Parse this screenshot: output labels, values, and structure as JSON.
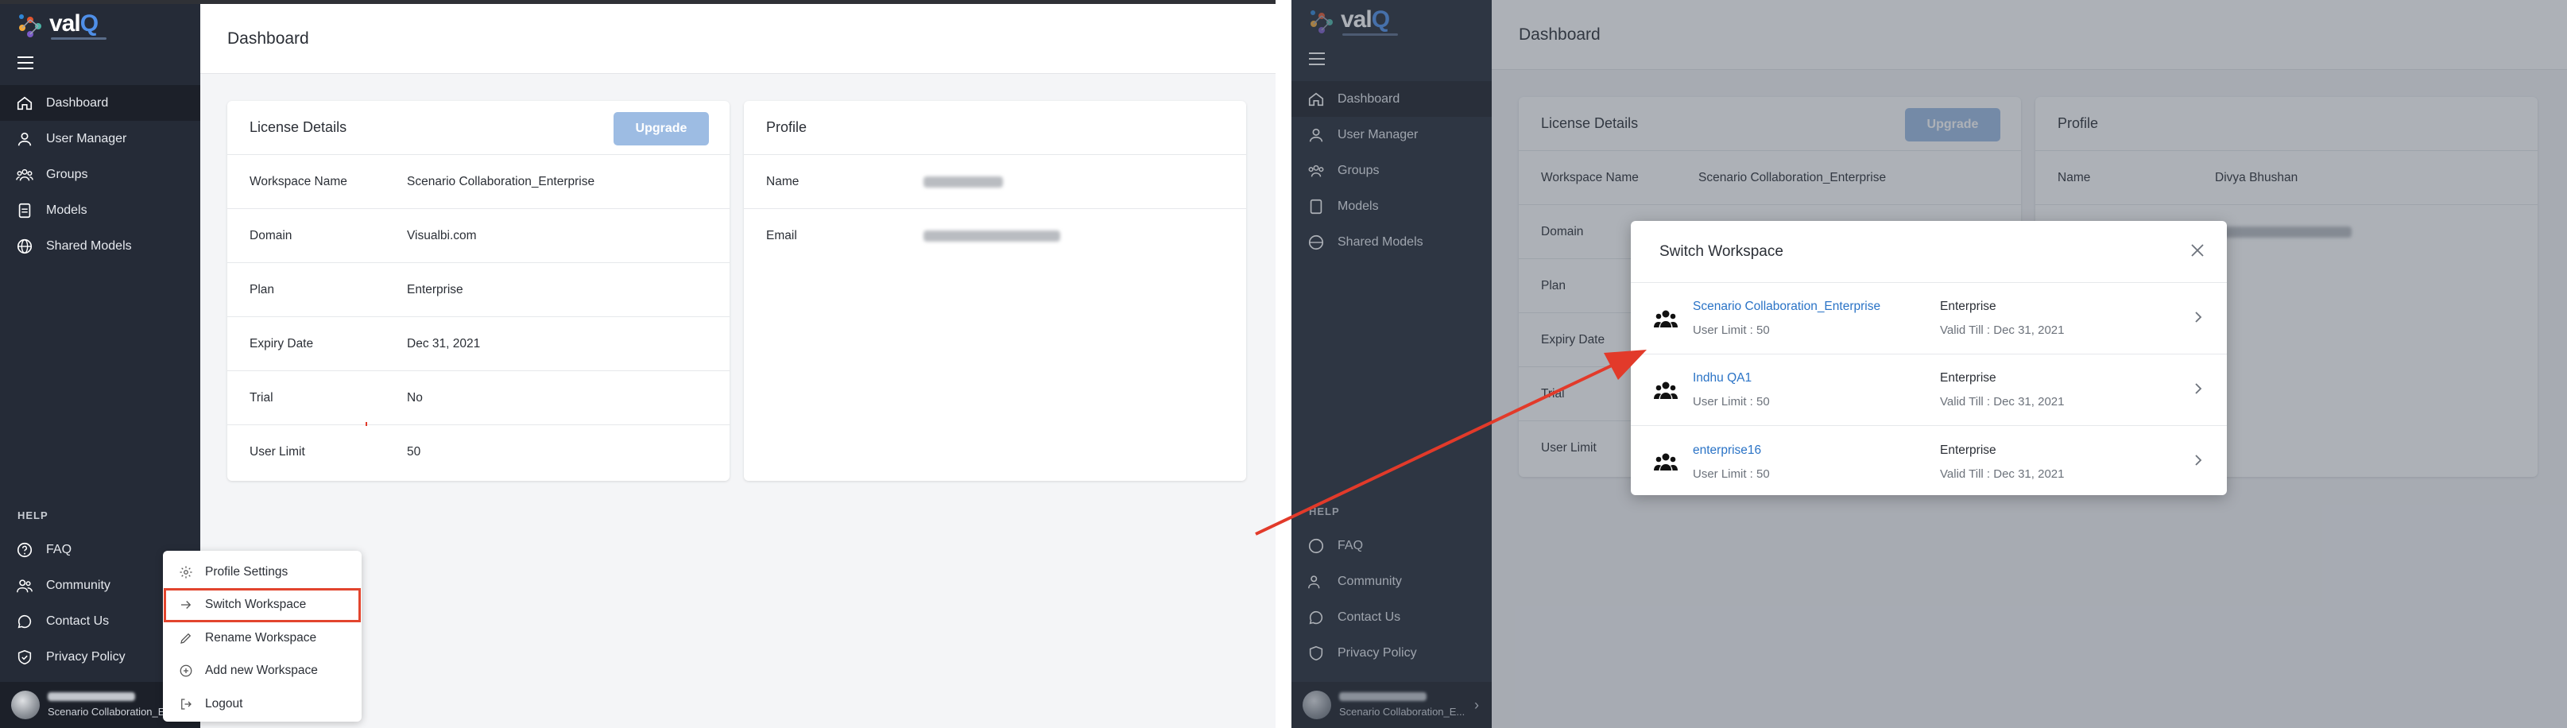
{
  "left": {
    "brand": {
      "word_a": "val",
      "word_b": "Q"
    },
    "nav": [
      {
        "label": "Dashboard",
        "icon": "home-icon",
        "active": true
      },
      {
        "label": "User Manager",
        "icon": "user-icon"
      },
      {
        "label": "Groups",
        "icon": "groups-icon"
      },
      {
        "label": "Models",
        "icon": "document-icon"
      },
      {
        "label": "Shared Models",
        "icon": "globe-icon"
      }
    ],
    "help_title": "HELP",
    "help": [
      {
        "label": "FAQ",
        "icon": "question-icon"
      },
      {
        "label": "Community",
        "icon": "community-icon"
      },
      {
        "label": "Contact Us",
        "icon": "chat-icon"
      },
      {
        "label": "Privacy Policy",
        "icon": "shield-icon"
      }
    ],
    "user_workspace": "Scenario Collaboration_E",
    "page_title": "Dashboard",
    "license": {
      "title": "License Details",
      "upgrade": "Upgrade",
      "rows": [
        {
          "k": "Workspace Name",
          "v": "Scenario Collaboration_Enterprise"
        },
        {
          "k": "Domain",
          "v": "Visualbi.com"
        },
        {
          "k": "Plan",
          "v": "Enterprise"
        },
        {
          "k": "Expiry Date",
          "v": "Dec 31, 2021"
        },
        {
          "k": "Trial",
          "v": "No"
        },
        {
          "k": "User Limit",
          "v": "50"
        }
      ]
    },
    "profile": {
      "title": "Profile",
      "name_label": "Name",
      "email_label": "Email"
    },
    "menu": [
      {
        "label": "Profile Settings",
        "icon": "gear-icon"
      },
      {
        "label": "Switch Workspace",
        "icon": "arrow-right-icon",
        "highlight": true
      },
      {
        "label": "Rename Workspace",
        "icon": "pencil-icon"
      },
      {
        "label": "Add new Workspace",
        "icon": "plus-circle-icon"
      },
      {
        "label": "Logout",
        "icon": "logout-icon"
      }
    ]
  },
  "right": {
    "user_workspace": "Scenario Collaboration_E...",
    "profile_name": "Divya Bhushan",
    "modal": {
      "title": "Switch Workspace",
      "workspaces": [
        {
          "name": "Scenario Collaboration_Enterprise",
          "limit": "User Limit : 50",
          "plan": "Enterprise",
          "valid": "Valid Till : Dec 31, 2021"
        },
        {
          "name": "Indhu QA1",
          "limit": "User Limit : 50",
          "plan": "Enterprise",
          "valid": "Valid Till : Dec 31, 2021"
        },
        {
          "name": "enterprise16",
          "limit": "User Limit : 50",
          "plan": "Enterprise",
          "valid": "Valid Till : Dec 31, 2021"
        }
      ]
    }
  },
  "colors": {
    "sidebar": "#252b37",
    "accent_link": "#2a73c6",
    "upgrade": "#9dbce3",
    "annotation_red": "#e2452e"
  }
}
